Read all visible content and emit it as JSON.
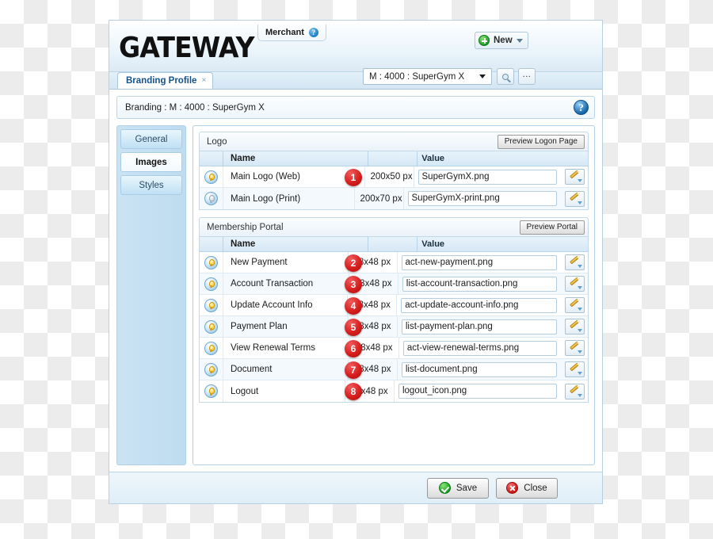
{
  "header": {
    "brand": "GATEWAY",
    "merchant_tab_label": "Merchant",
    "merchant_help_glyph": "?",
    "new_button_label": "New",
    "merchant_select_value": "M : 4000 : SuperGym X",
    "search_icon_name": "search-icon",
    "more_button_label": "..."
  },
  "tabs": [
    {
      "label": "Branding Profile",
      "close_glyph": "×"
    }
  ],
  "branding_bar": {
    "title": "Branding : M : 4000 : SuperGym X",
    "help_glyph": "?"
  },
  "sidebar": {
    "items": [
      {
        "label": "General"
      },
      {
        "label": "Images"
      },
      {
        "label": "Styles"
      }
    ]
  },
  "sections": [
    {
      "title": "Logo",
      "preview_label": "Preview Logon Page",
      "columns": {
        "name": "Name",
        "size": "",
        "value": "Value"
      },
      "rows": [
        {
          "badge": "1",
          "bulb": "lit",
          "name": "Main Logo (Web)",
          "size": "200x50 px",
          "value": "SuperGymX.png"
        },
        {
          "badge": "",
          "bulb": "dim",
          "name": "Main Logo (Print)",
          "size": "200x70 px",
          "value": "SuperGymX-print.png"
        }
      ]
    },
    {
      "title": "Membership Portal",
      "preview_label": "Preview Portal",
      "columns": {
        "name": "Name",
        "size": "",
        "value": "Value"
      },
      "rows": [
        {
          "badge": "2",
          "bulb": "lit",
          "name": "New Payment",
          "size": "48x48 px",
          "value": "act-new-payment.png"
        },
        {
          "badge": "3",
          "bulb": "lit",
          "name": "Account Transaction",
          "size": "48x48 px",
          "value": "list-account-transaction.png"
        },
        {
          "badge": "4",
          "bulb": "lit",
          "name": "Update Account Info",
          "size": "48x48 px",
          "value": "act-update-account-info.png"
        },
        {
          "badge": "5",
          "bulb": "lit",
          "name": "Payment Plan",
          "size": "48x48 px",
          "value": "list-payment-plan.png"
        },
        {
          "badge": "6",
          "bulb": "lit",
          "name": "View Renewal Terms",
          "size": "48x48 px",
          "value": "act-view-renewal-terms.png"
        },
        {
          "badge": "7",
          "bulb": "lit",
          "name": "Document",
          "size": "48x48 px",
          "value": "list-document.png"
        },
        {
          "badge": "8",
          "bulb": "lit",
          "name": "Logout",
          "size": "48x48 px",
          "value": "logout_icon.png"
        }
      ]
    }
  ],
  "footer": {
    "save_label": "Save",
    "close_label": "Close"
  },
  "colors": {
    "badge_red": "#d81f1f",
    "accent_blue": "#14528c",
    "sidebar_blue": "#bfdcf0",
    "panel_border": "#b2d0e5",
    "bulb_yellow": "#f5bd12"
  }
}
